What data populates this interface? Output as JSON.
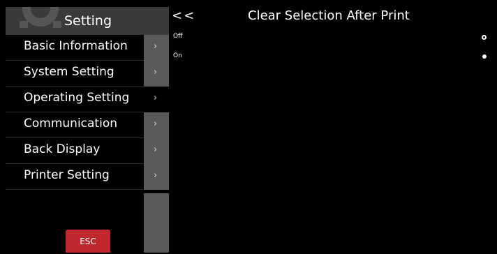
{
  "sidebar": {
    "title": "Setting",
    "items": [
      {
        "label": "Basic Information",
        "arrow": "›"
      },
      {
        "label": "System Setting",
        "arrow": "›"
      },
      {
        "label": "Operating Setting",
        "arrow": "›"
      },
      {
        "label": "Communication",
        "arrow": "›"
      },
      {
        "label": "Back Display",
        "arrow": "›"
      },
      {
        "label": "Printer Setting",
        "arrow": "›"
      }
    ],
    "esc_label": "ESC"
  },
  "header": {
    "back_label": "<<",
    "title": "Clear Selection After Print"
  },
  "options": [
    {
      "label": "Off",
      "selected": false
    },
    {
      "label": "On",
      "selected": true
    }
  ]
}
